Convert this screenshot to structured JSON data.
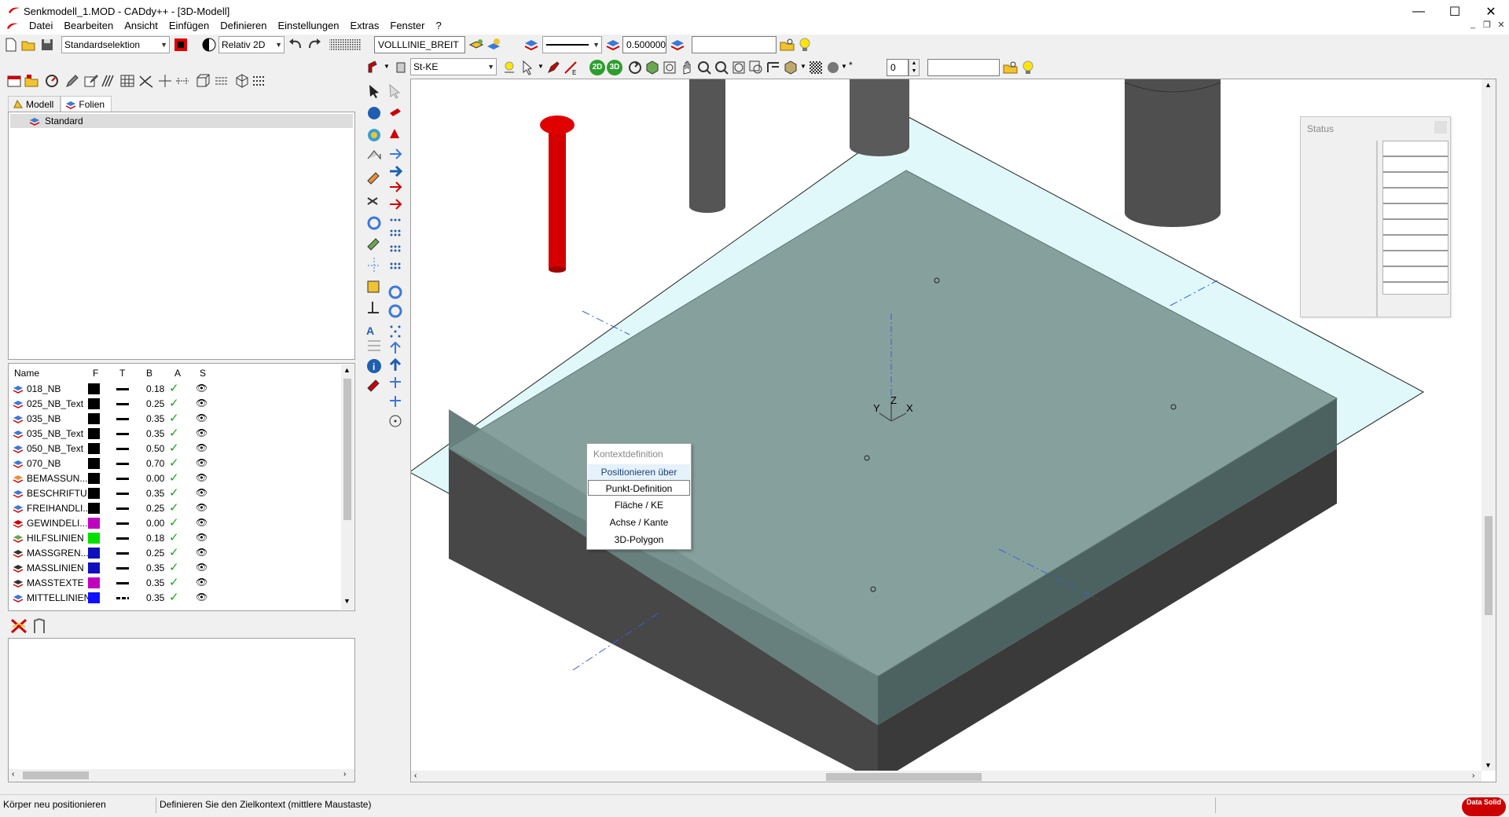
{
  "window": {
    "title": "Senkmodell_1.MOD  -  CADdy++ - [3D-Modell]",
    "minimize": "—",
    "maximize": "☐",
    "close": "✕"
  },
  "menu": [
    "Datei",
    "Bearbeiten",
    "Ansicht",
    "Einfügen",
    "Definieren",
    "Einstellungen",
    "Extras",
    "Fenster",
    "?"
  ],
  "toolbar1": {
    "selection_mode": "Standardselektion",
    "coord_mode": "Relativ 2D",
    "linetype_name": "VOLLLINIE_BREIT",
    "line_width": "0.500000",
    "search_value": ""
  },
  "toolbar2": {
    "element_type": "St-KE",
    "btn_2d": "2D",
    "btn_3d": "3D",
    "number_value": "0",
    "search_value": ""
  },
  "left_tabs": [
    "Modell",
    "Folien"
  ],
  "tree": {
    "root": "Standard"
  },
  "layer_table": {
    "headers": [
      "Name",
      "F",
      "T",
      "B",
      "A",
      "S"
    ],
    "rows": [
      {
        "name": "018_NB",
        "color": "#000000",
        "width": "0.18"
      },
      {
        "name": "025_NB_Text",
        "color": "#000000",
        "width": "0.25"
      },
      {
        "name": "035_NB",
        "color": "#000000",
        "width": "0.35"
      },
      {
        "name": "035_NB_Text",
        "color": "#000000",
        "width": "0.35"
      },
      {
        "name": "050_NB_Text",
        "color": "#000000",
        "width": "0.50"
      },
      {
        "name": "070_NB",
        "color": "#000000",
        "width": "0.70"
      },
      {
        "name": "BEMASSUN...",
        "color": "#000000",
        "width": "0.00"
      },
      {
        "name": "BESCHRIFTU...",
        "color": "#000000",
        "width": "0.35"
      },
      {
        "name": "FREIHANDLI...",
        "color": "#000000",
        "width": "0.25"
      },
      {
        "name": "GEWINDELI...",
        "color": "#c000c0",
        "width": "0.00"
      },
      {
        "name": "HILFSLINIEN",
        "color": "#00e000",
        "width": "0.18"
      },
      {
        "name": "MASSGREN...",
        "color": "#1010c0",
        "width": "0.25"
      },
      {
        "name": "MASSLINIEN",
        "color": "#1010c0",
        "width": "0.35"
      },
      {
        "name": "MASSTEXTE",
        "color": "#c000c0",
        "width": "0.35"
      },
      {
        "name": "MITTELLINIEN",
        "color": "#1010ff",
        "width": "0.35"
      }
    ]
  },
  "context_menu": {
    "header": "Kontextdefinition",
    "items": [
      "Positionieren über",
      "Punkt-Definition",
      "Fläche / KE",
      "Achse / Kante",
      "3D-Polygon"
    ]
  },
  "status_panel": {
    "title": "Status"
  },
  "axis_labels": {
    "x": "X",
    "y": "Y",
    "z": "Z"
  },
  "statusbar": {
    "left": "Körper neu positionieren",
    "message": "Definieren Sie den Zielkontext (mittlere Maustaste)",
    "logo": "Data Solid"
  },
  "colors": {
    "plate_top": "#86a09e",
    "plate_front": "#5c7472",
    "base_side": "#474747",
    "workplane": "#e0f8fa",
    "pin_red": "#d40000",
    "cylinder": "#555555"
  }
}
